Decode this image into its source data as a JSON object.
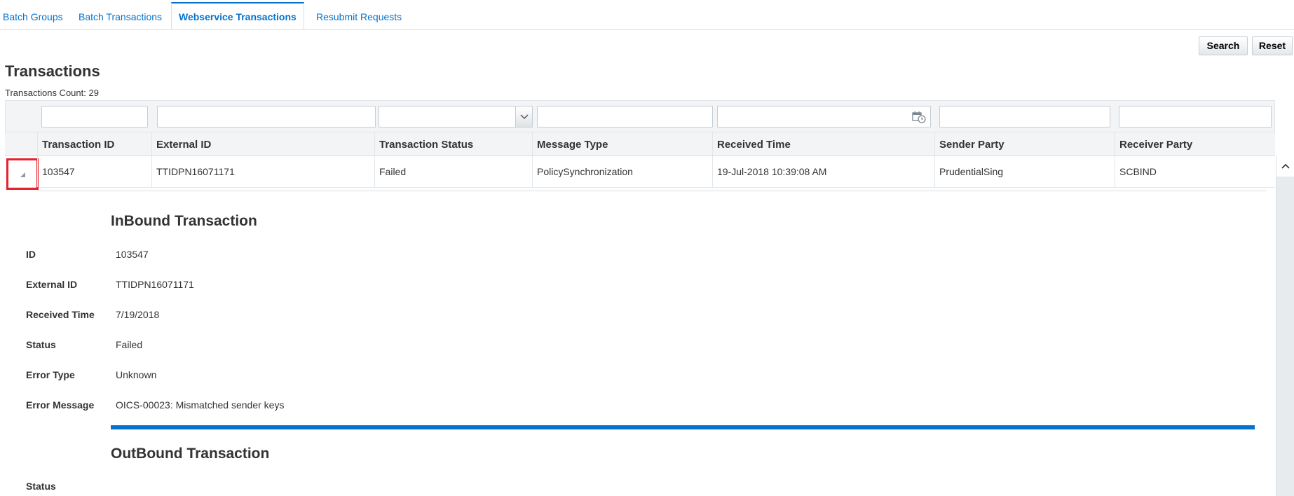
{
  "tabs": [
    {
      "label": "Batch Groups"
    },
    {
      "label": "Batch Transactions"
    },
    {
      "label": "Webservice Transactions"
    },
    {
      "label": "Resubmit Requests"
    }
  ],
  "toolbar": {
    "search_label": "Search",
    "reset_label": "Reset"
  },
  "section": {
    "title": "Transactions",
    "count_label": "Transactions Count: 29"
  },
  "table": {
    "columns": [
      "Transaction ID",
      "External ID",
      "Transaction Status",
      "Message Type",
      "Received Time",
      "Sender Party",
      "Receiver Party"
    ],
    "rows": [
      {
        "transaction_id": "103547",
        "external_id": "TTIDPN16071171",
        "status": "Failed",
        "message_type": "PolicySynchronization",
        "received_time": "19-Jul-2018 10:39:08 AM",
        "sender_party": "PrudentialSing",
        "receiver_party": "SCBIND"
      }
    ]
  },
  "inbound": {
    "title": "InBound Transaction",
    "fields": [
      {
        "label": "ID",
        "value": "103547"
      },
      {
        "label": "External ID",
        "value": "TTIDPN16071171"
      },
      {
        "label": "Received Time",
        "value": "7/19/2018"
      },
      {
        "label": "Status",
        "value": "Failed"
      },
      {
        "label": "Error Type",
        "value": "Unknown"
      },
      {
        "label": "Error Message",
        "value": "OICS-00023: Mismatched sender keys"
      }
    ]
  },
  "outbound": {
    "title": "OutBound Transaction",
    "fields": [
      {
        "label": "Status",
        "value": ""
      }
    ]
  },
  "colors": {
    "accent": "#0572ce",
    "highlight": "#e8212b"
  },
  "icons": [
    "chevron-down-icon",
    "calendar-clock-icon",
    "expand-triangle-icon",
    "scroll-up-icon"
  ]
}
